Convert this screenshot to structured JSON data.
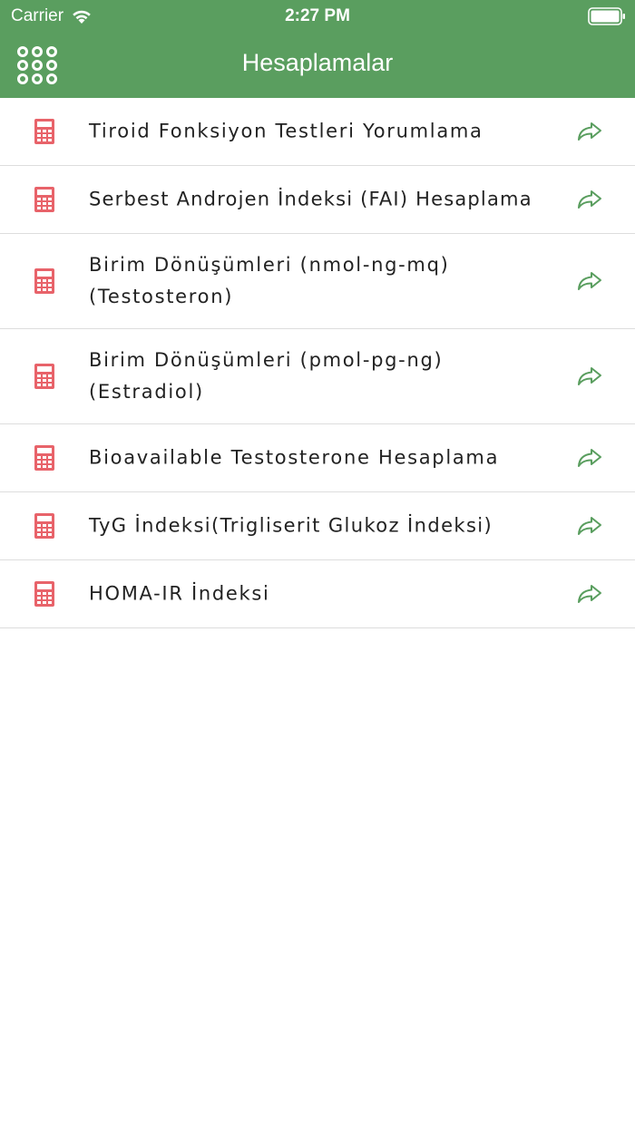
{
  "status_bar": {
    "carrier": "Carrier",
    "time": "2:27 PM",
    "icons": [
      "wifi-icon",
      "battery-icon"
    ]
  },
  "nav": {
    "title": "Hesaplamalar",
    "menu_icon": "grid-menu-icon"
  },
  "items": [
    {
      "label": "Tiroid Fonksiyon Testleri Yorumlama",
      "icon": "calculator-icon",
      "action_icon": "share-arrow-icon"
    },
    {
      "label": "Serbest Androjen İndeksi (FAI) Hesaplama",
      "icon": "calculator-icon",
      "action_icon": "share-arrow-icon"
    },
    {
      "label": "Birim Dönüşümleri (nmol-ng-mq) (Testosteron)",
      "icon": "calculator-icon",
      "action_icon": "share-arrow-icon"
    },
    {
      "label": "Birim Dönüşümleri (pmol-pg-ng) (Estradiol)",
      "icon": "calculator-icon",
      "action_icon": "share-arrow-icon"
    },
    {
      "label": "Bioavailable Testosterone Hesaplama",
      "icon": "calculator-icon",
      "action_icon": "share-arrow-icon"
    },
    {
      "label": "TyG İndeksi(Trigliserit Glukoz İndeksi)",
      "icon": "calculator-icon",
      "action_icon": "share-arrow-icon"
    },
    {
      "label": "HOMA-IR İndeksi",
      "icon": "calculator-icon",
      "action_icon": "share-arrow-icon"
    }
  ],
  "colors": {
    "header_green": "#5a9e5f",
    "calculator_red": "#e8636a",
    "arrow_green": "#5a9e5f",
    "divider": "#dddddd"
  }
}
